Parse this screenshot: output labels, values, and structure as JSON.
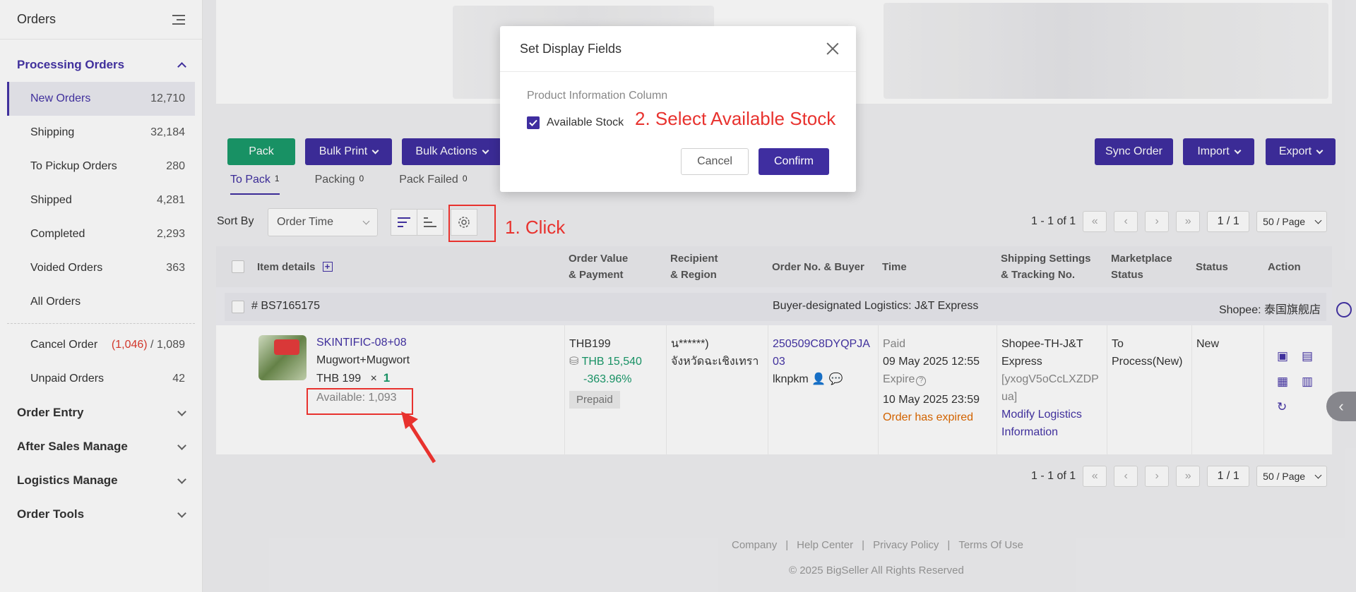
{
  "sidebar": {
    "title": "Orders",
    "group_processing": "Processing Orders",
    "items": [
      {
        "label": "New Orders",
        "count": "12,710"
      },
      {
        "label": "Shipping",
        "count": "32,184"
      },
      {
        "label": "To Pickup Orders",
        "count": "280"
      },
      {
        "label": "Shipped",
        "count": "4,281"
      },
      {
        "label": "Completed",
        "count": "2,293"
      },
      {
        "label": "Voided Orders",
        "count": "363"
      },
      {
        "label": "All Orders",
        "count": ""
      }
    ],
    "cancel_order": {
      "label": "Cancel Order",
      "count_red": "(1,046)",
      "count_sep": "/",
      "count_total": "1,089"
    },
    "unpaid_orders": {
      "label": "Unpaid Orders",
      "count": "42"
    },
    "groups": [
      "Order Entry",
      "After Sales Manage",
      "Logistics Manage",
      "Order Tools"
    ]
  },
  "toolbar": {
    "pack": "Pack",
    "bulk_print": "Bulk Print",
    "bulk_actions": "Bulk Actions",
    "sync_order": "Sync Order",
    "import": "Import",
    "export": "Export"
  },
  "tabs": [
    {
      "label": "To Pack",
      "count": "1"
    },
    {
      "label": "Packing",
      "count": "0"
    },
    {
      "label": "Pack Failed",
      "count": "0"
    }
  ],
  "sort": {
    "label": "Sort By",
    "value": "Order Time"
  },
  "pagination": {
    "range": "1 - 1 of 1",
    "page": "1 / 1",
    "per_page": "50 / Page"
  },
  "table": {
    "headers": {
      "item_details": "Item details",
      "order_value_1": "Order Value",
      "order_value_2": "& Payment",
      "recipient_1": "Recipient",
      "recipient_2": "& Region",
      "order_no": "Order No. & Buyer",
      "time": "Time",
      "shipping_1": "Shipping Settings",
      "shipping_2": "& Tracking No.",
      "marketplace_1": "Marketplace",
      "marketplace_2": "Status",
      "status": "Status",
      "action": "Action"
    },
    "group": {
      "id": "# BS7165175",
      "logistics": "Buyer-designated Logistics: J&T Express",
      "shop": "Shopee: 泰国旗舰店"
    },
    "row": {
      "product_sku": "SKINTIFIC-08+08",
      "product_name": "Mugwort+Mugwort",
      "price": "THB 199",
      "times": "×",
      "qty": "1",
      "available": "Available: 1,093",
      "order_value": "THB199",
      "order_value_2": "THB 15,540",
      "order_value_pct": "-363.96%",
      "payment": "Prepaid",
      "recipient": "น******)",
      "region": "จังหวัดฉะเชิงเทรา",
      "order_no_1": "250509C8DYQPJA",
      "order_no_2": "03",
      "buyer": "lknpkm",
      "paid_label": "Paid",
      "paid_time": "09 May 2025 12:55",
      "expire_label": "Expire",
      "expire_time": "10 May 2025 23:59",
      "expired_msg": "Order has expired",
      "shipping_1": "Shopee-TH-J&T",
      "shipping_2": "Express",
      "tracking_1": "[yxogV5oCcLXZDP",
      "tracking_2": "ua]",
      "modify_1": "Modify Logistics",
      "modify_2": "Information",
      "marketplace_1": "To",
      "marketplace_2": "Process(New)",
      "status": "New"
    }
  },
  "footer": {
    "links": [
      "Company",
      "Help Center",
      "Privacy Policy",
      "Terms Of Use"
    ],
    "sep": "|",
    "copyright": "© 2025 BigSeller All Rights Reserved"
  },
  "modal": {
    "title": "Set Display Fields",
    "section": "Product Information Column",
    "option": "Available Stock",
    "cancel": "Cancel",
    "confirm": "Confirm"
  },
  "annotations": {
    "step1": "1. Click",
    "step2": "2. Select Available Stock"
  },
  "colors": {
    "accent": "#3f2ea0",
    "green": "#1a9b6b",
    "annotation_red": "#e8322e"
  }
}
